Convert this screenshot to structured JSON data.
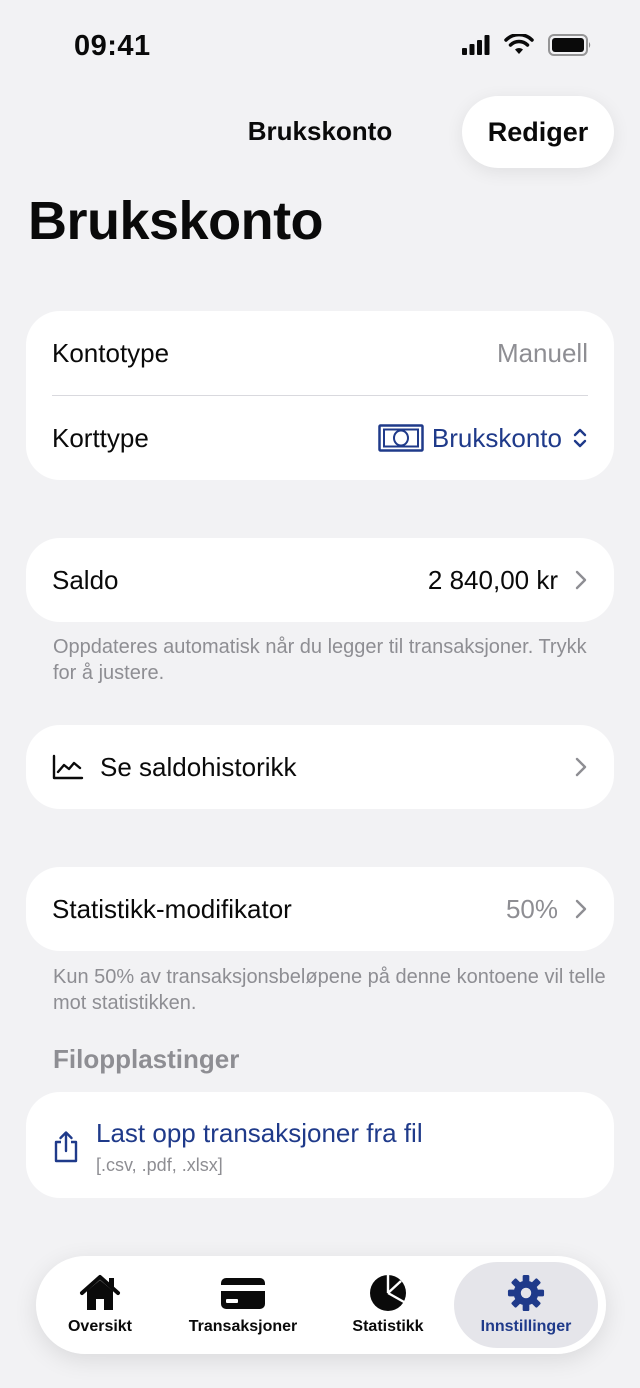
{
  "status_bar": {
    "time": "09:41"
  },
  "nav": {
    "title": "Brukskonto",
    "edit_label": "Rediger"
  },
  "large_title": "Brukskonto",
  "account_card": {
    "kontotype_label": "Kontotype",
    "kontotype_value": "Manuell",
    "korttype_label": "Korttype",
    "korttype_value": "Brukskonto"
  },
  "saldo": {
    "label": "Saldo",
    "value": "2 840,00 kr",
    "footnote": "Oppdateres automatisk når du legger til transaksjoner. Trykk for å justere."
  },
  "history": {
    "label": "Se saldohistorikk"
  },
  "stat_modifier": {
    "label": "Statistikk-modifikator",
    "value": "50%",
    "footnote": "Kun 50% av transaksjonsbeløpene på denne kontoene vil telle mot statistikken."
  },
  "uploads": {
    "header": "Filopplastinger",
    "title": "Last opp transaksjoner fra fil",
    "subtitle": "[.csv, .pdf, .xlsx]"
  },
  "tabs": [
    {
      "label": "Oversikt",
      "icon": "house-icon"
    },
    {
      "label": "Transaksjoner",
      "icon": "credit-card-icon"
    },
    {
      "label": "Statistikk",
      "icon": "pie-chart-icon"
    },
    {
      "label": "Innstillinger",
      "icon": "gear-icon",
      "active": true
    }
  ],
  "colors": {
    "accent": "#1f3a8a",
    "background": "#f2f2f4",
    "secondary_text": "#8e8e93"
  }
}
